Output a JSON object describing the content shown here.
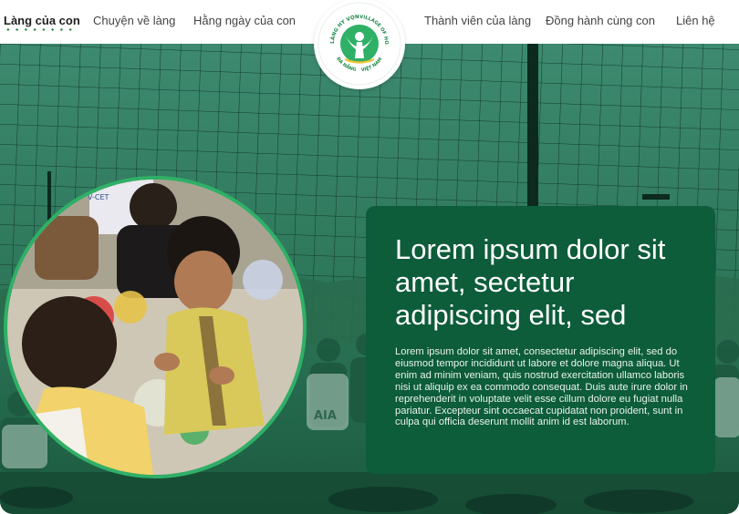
{
  "nav": {
    "left_items": [
      {
        "label": "Làng của con",
        "active": true
      },
      {
        "label": "Chuyện về làng",
        "active": false
      },
      {
        "label": "Hằng ngày của con",
        "active": false
      }
    ],
    "right_items": [
      {
        "label": "Thành viên của làng"
      },
      {
        "label": "Đồng hành cùng con"
      },
      {
        "label": "Liên hệ"
      }
    ]
  },
  "logo": {
    "top_left_text": "LÀNG HY VỌNG",
    "top_right_text": "VILLAGE OF HOPE",
    "bottom_left_text": "ĐÀ NẴNG",
    "bottom_right_text": "VIỆT NAM"
  },
  "hero": {
    "title": "Lorem ipsum dolor sit amet, sectetur adipiscing elit, sed",
    "body": "Lorem ipsum dolor sit amet, consectetur adipiscing elit, sed do eiusmod tempor incididunt ut labore et dolore magna aliqua. Ut enim ad minim veniam, quis nostrud exercitation ullamco laboris nisi ut aliquip ex ea commodo consequat. Duis aute irure dolor in reprehenderit in voluptate velit esse cillum dolore eu fugiat nulla pariatur. Excepteur sint occaecat cupidatat non proident, sunt in culpa qui officia deserunt mollit anim id est laborum.",
    "photo_shirt_text": "V-CET",
    "background_shirt_text": "AIA"
  },
  "colors": {
    "brand_green": "#2fb067",
    "card_green": "#0d5c3a",
    "overlay_green": "#1e6b4e",
    "logo_accent": "#f2c12e"
  },
  "icons": {
    "play": "play-icon",
    "logo": "village-of-hope-logo"
  }
}
